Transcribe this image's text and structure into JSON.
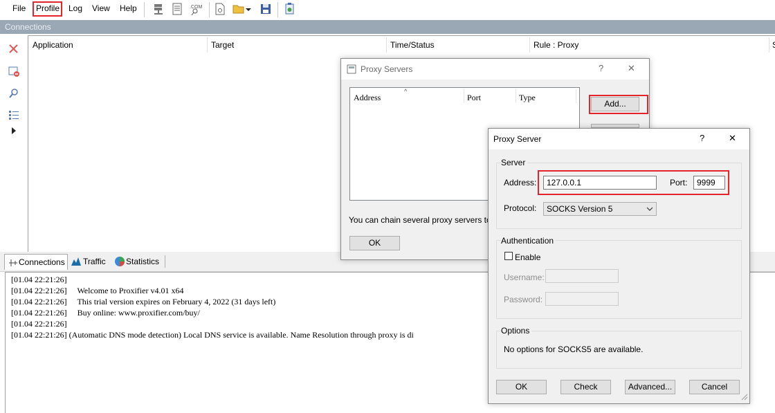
{
  "menu": {
    "file": "File",
    "profile": "Profile",
    "log": "Log",
    "view": "View",
    "help": "Help"
  },
  "toolbar": {
    "icons": [
      "proxy-servers-icon",
      "proxification-rules-icon",
      "name-resolution-icon",
      "new-profile-icon",
      "open-profile-icon",
      "dropdown-arrow-icon",
      "save-profile-icon",
      "advanced-settings-icon"
    ]
  },
  "connections_panel": {
    "title": "Connections",
    "columns": [
      "Application",
      "Target",
      "Time/Status",
      "Rule : Proxy",
      "S"
    ]
  },
  "side_toolbar": {
    "icons": [
      "close-connection-icon",
      "remove-icon",
      "search-icon",
      "list-icon",
      "play-icon"
    ]
  },
  "tabs": [
    "Connections",
    "Traffic",
    "Statistics"
  ],
  "log": {
    "lines": [
      "[01.04 22:21:26]",
      "[01.04 22:21:26]     Welcome to Proxifier v4.01 x64",
      "[01.04 22:21:26]     This trial version expires on February 4, 2022 (31 days left)",
      "[01.04 22:21:26]     Buy online: www.proxifier.com/buy/",
      "[01.04 22:21:26]",
      "[01.04 22:21:26] (Automatic DNS mode detection) Local DNS service is available. Name Resolution through proxy is di"
    ]
  },
  "proxy_servers_dialog": {
    "title": "Proxy Servers",
    "help": "?",
    "close": "✕",
    "columns": [
      "Address",
      "Port",
      "Type"
    ],
    "add_button": "Add...",
    "chain_text": "You can chain several proxy servers toget",
    "ok_button": "OK"
  },
  "proxy_server_dialog": {
    "title": "Proxy Server",
    "help": "?",
    "close": "✕",
    "server_group": "Server",
    "address_label": "Address:",
    "address_value": "127.0.0.1",
    "port_label": "Port:",
    "port_value": "9999",
    "protocol_label": "Protocol:",
    "protocol_value": "SOCKS Version 5",
    "auth_group": "Authentication",
    "enable_label": "Enable",
    "enable_checked": false,
    "username_label": "Username:",
    "password_label": "Password:",
    "options_group": "Options",
    "options_text": "No options for SOCKS5 are available.",
    "buttons": {
      "ok": "OK",
      "check": "Check",
      "advanced": "Advanced...",
      "cancel": "Cancel"
    }
  },
  "colors": {
    "highlight": "#e3242b",
    "panel_header": "#9aa7b4"
  }
}
